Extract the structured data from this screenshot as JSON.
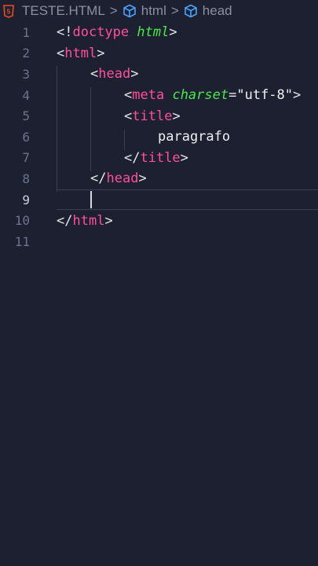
{
  "breadcrumb": {
    "file": "TESTE.HTML",
    "items": [
      "html",
      "head"
    ],
    "separator": ">"
  },
  "colors": {
    "background": "#1c2030",
    "tag": "#ff4f9a",
    "attribute": "#49e84a",
    "text": "#f0f0f0",
    "line_number": "#6b7394",
    "html5_icon": "#e44d26"
  },
  "editor": {
    "line_numbers": [
      "1",
      "2",
      "3",
      "4",
      "5",
      "6",
      "7",
      "8",
      "9",
      "10",
      "11"
    ],
    "cursor_line": 9,
    "lines": [
      {
        "num": "1",
        "tokens": [
          {
            "t": "<!",
            "c": "punc"
          },
          {
            "t": "doctype",
            "c": "kw"
          },
          {
            "t": " ",
            "c": "punc"
          },
          {
            "t": "html",
            "c": "attr"
          },
          {
            "t": ">",
            "c": "punc"
          }
        ]
      },
      {
        "num": "2",
        "tokens": [
          {
            "t": "<",
            "c": "punc"
          },
          {
            "t": "html",
            "c": "tag"
          },
          {
            "t": ">",
            "c": "punc"
          }
        ]
      },
      {
        "num": "3",
        "tokens": [
          {
            "t": "<",
            "c": "punc"
          },
          {
            "t": "head",
            "c": "tag"
          },
          {
            "t": ">",
            "c": "punc"
          }
        ]
      },
      {
        "num": "4",
        "tokens": [
          {
            "t": "<",
            "c": "punc"
          },
          {
            "t": "meta",
            "c": "tag"
          },
          {
            "t": " ",
            "c": "punc"
          },
          {
            "t": "charset",
            "c": "attr"
          },
          {
            "t": "=",
            "c": "punc"
          },
          {
            "t": "\"utf-8\"",
            "c": "str"
          },
          {
            "t": ">",
            "c": "punc"
          }
        ]
      },
      {
        "num": "5",
        "tokens": [
          {
            "t": "<",
            "c": "punc"
          },
          {
            "t": "title",
            "c": "tag"
          },
          {
            "t": ">",
            "c": "punc"
          }
        ]
      },
      {
        "num": "6",
        "tokens": [
          {
            "t": "paragrafo",
            "c": "text"
          }
        ]
      },
      {
        "num": "7",
        "tokens": [
          {
            "t": "</",
            "c": "punc"
          },
          {
            "t": "title",
            "c": "tag"
          },
          {
            "t": ">",
            "c": "punc"
          }
        ]
      },
      {
        "num": "8",
        "tokens": [
          {
            "t": "</",
            "c": "punc"
          },
          {
            "t": "head",
            "c": "tag"
          },
          {
            "t": ">",
            "c": "punc"
          }
        ]
      },
      {
        "num": "9",
        "tokens": []
      },
      {
        "num": "10",
        "tokens": [
          {
            "t": "</",
            "c": "punc"
          },
          {
            "t": "html",
            "c": "tag"
          },
          {
            "t": ">",
            "c": "punc"
          }
        ]
      },
      {
        "num": "11",
        "tokens": []
      }
    ]
  }
}
